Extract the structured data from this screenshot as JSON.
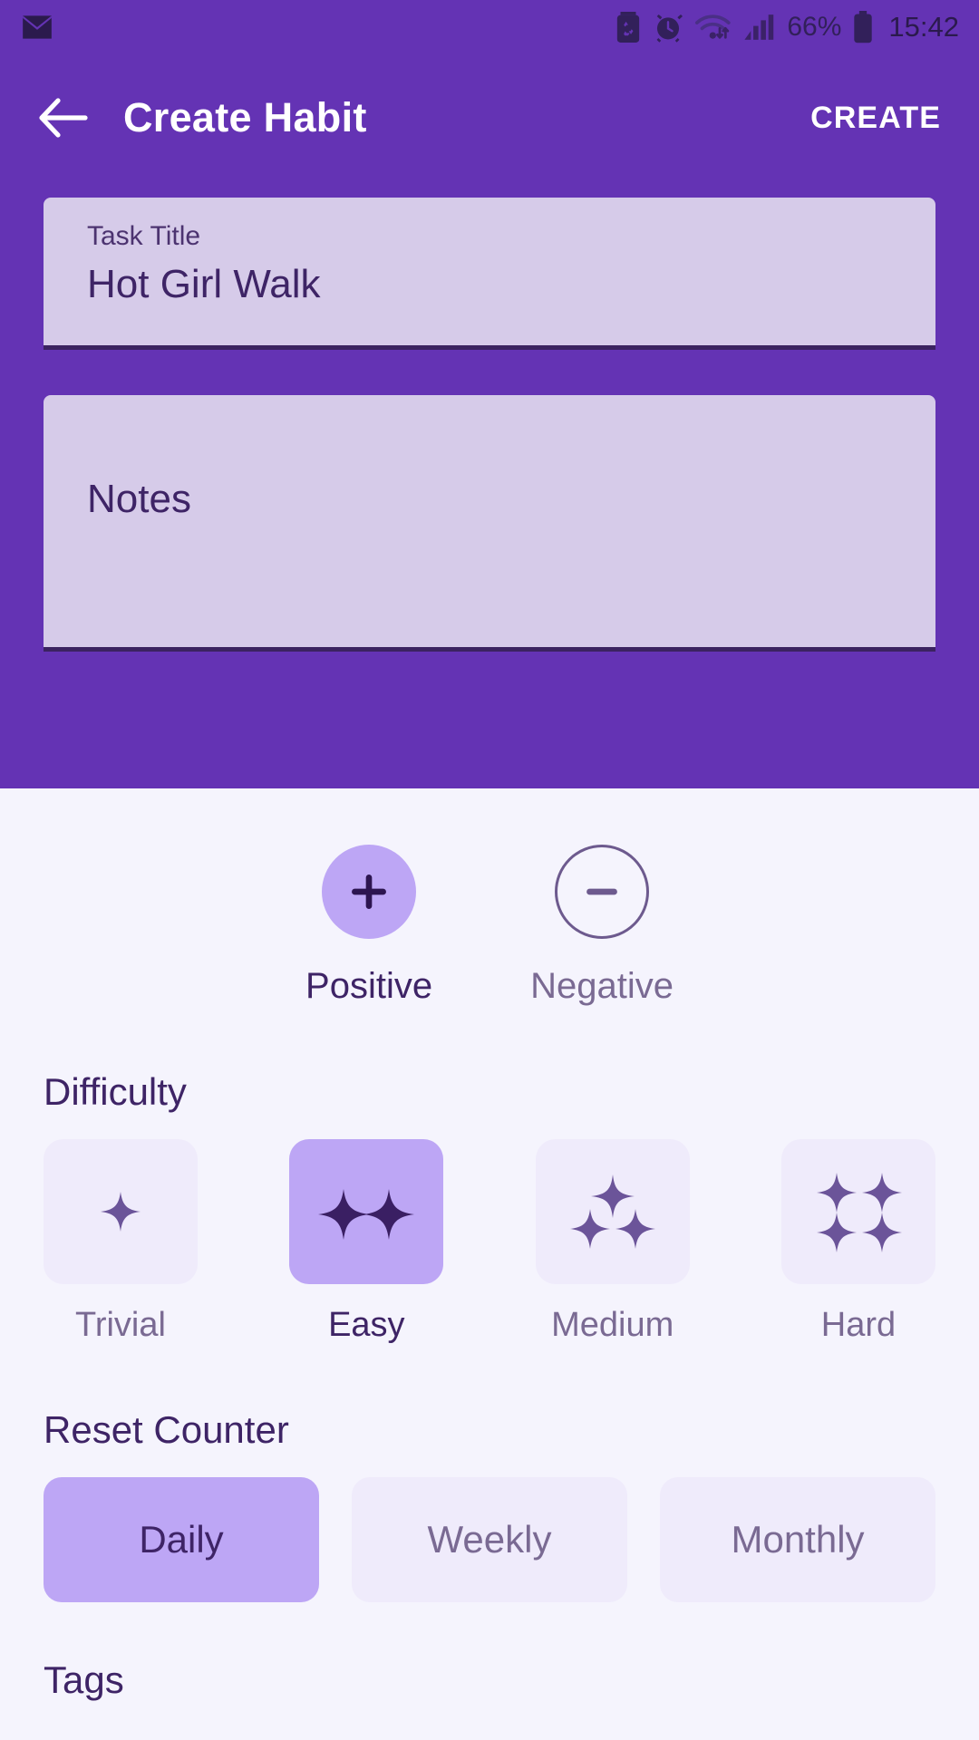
{
  "statusbar": {
    "icons_left": [
      "mail-icon"
    ],
    "icons_right": [
      "battery-saver-icon",
      "alarm-icon",
      "wifi-icon",
      "signal-icon"
    ],
    "battery_percent": "66%",
    "time": "15:42"
  },
  "appbar": {
    "back_icon": "arrow-left-icon",
    "title": "Create Habit",
    "create_label": "CREATE"
  },
  "form": {
    "task_title": {
      "label": "Task Title",
      "value": "Hot Girl Walk"
    },
    "notes": {
      "placeholder": "Notes",
      "value": ""
    }
  },
  "polarity": {
    "options": [
      {
        "label": "Positive",
        "icon": "plus-icon",
        "selected": true
      },
      {
        "label": "Negative",
        "icon": "minus-icon",
        "selected": false
      }
    ]
  },
  "difficulty": {
    "heading": "Difficulty",
    "options": [
      {
        "label": "Trivial",
        "sparkles": 1,
        "selected": false
      },
      {
        "label": "Easy",
        "sparkles": 2,
        "selected": true
      },
      {
        "label": "Medium",
        "sparkles": 3,
        "selected": false
      },
      {
        "label": "Hard",
        "sparkles": 4,
        "selected": false
      }
    ]
  },
  "reset_counter": {
    "heading": "Reset Counter",
    "options": [
      {
        "label": "Daily",
        "selected": true
      },
      {
        "label": "Weekly",
        "selected": false
      },
      {
        "label": "Monthly",
        "selected": false
      }
    ]
  },
  "tags": {
    "heading": "Tags"
  },
  "colors": {
    "primary": "#6433b4",
    "field_bg": "#d6cbe9",
    "body_bg": "#f5f4fd",
    "accent_selected": "#bda6f5",
    "card_unselected": "#efebfb",
    "text_dark": "#3e2466",
    "text_muted": "#7a6a93"
  }
}
